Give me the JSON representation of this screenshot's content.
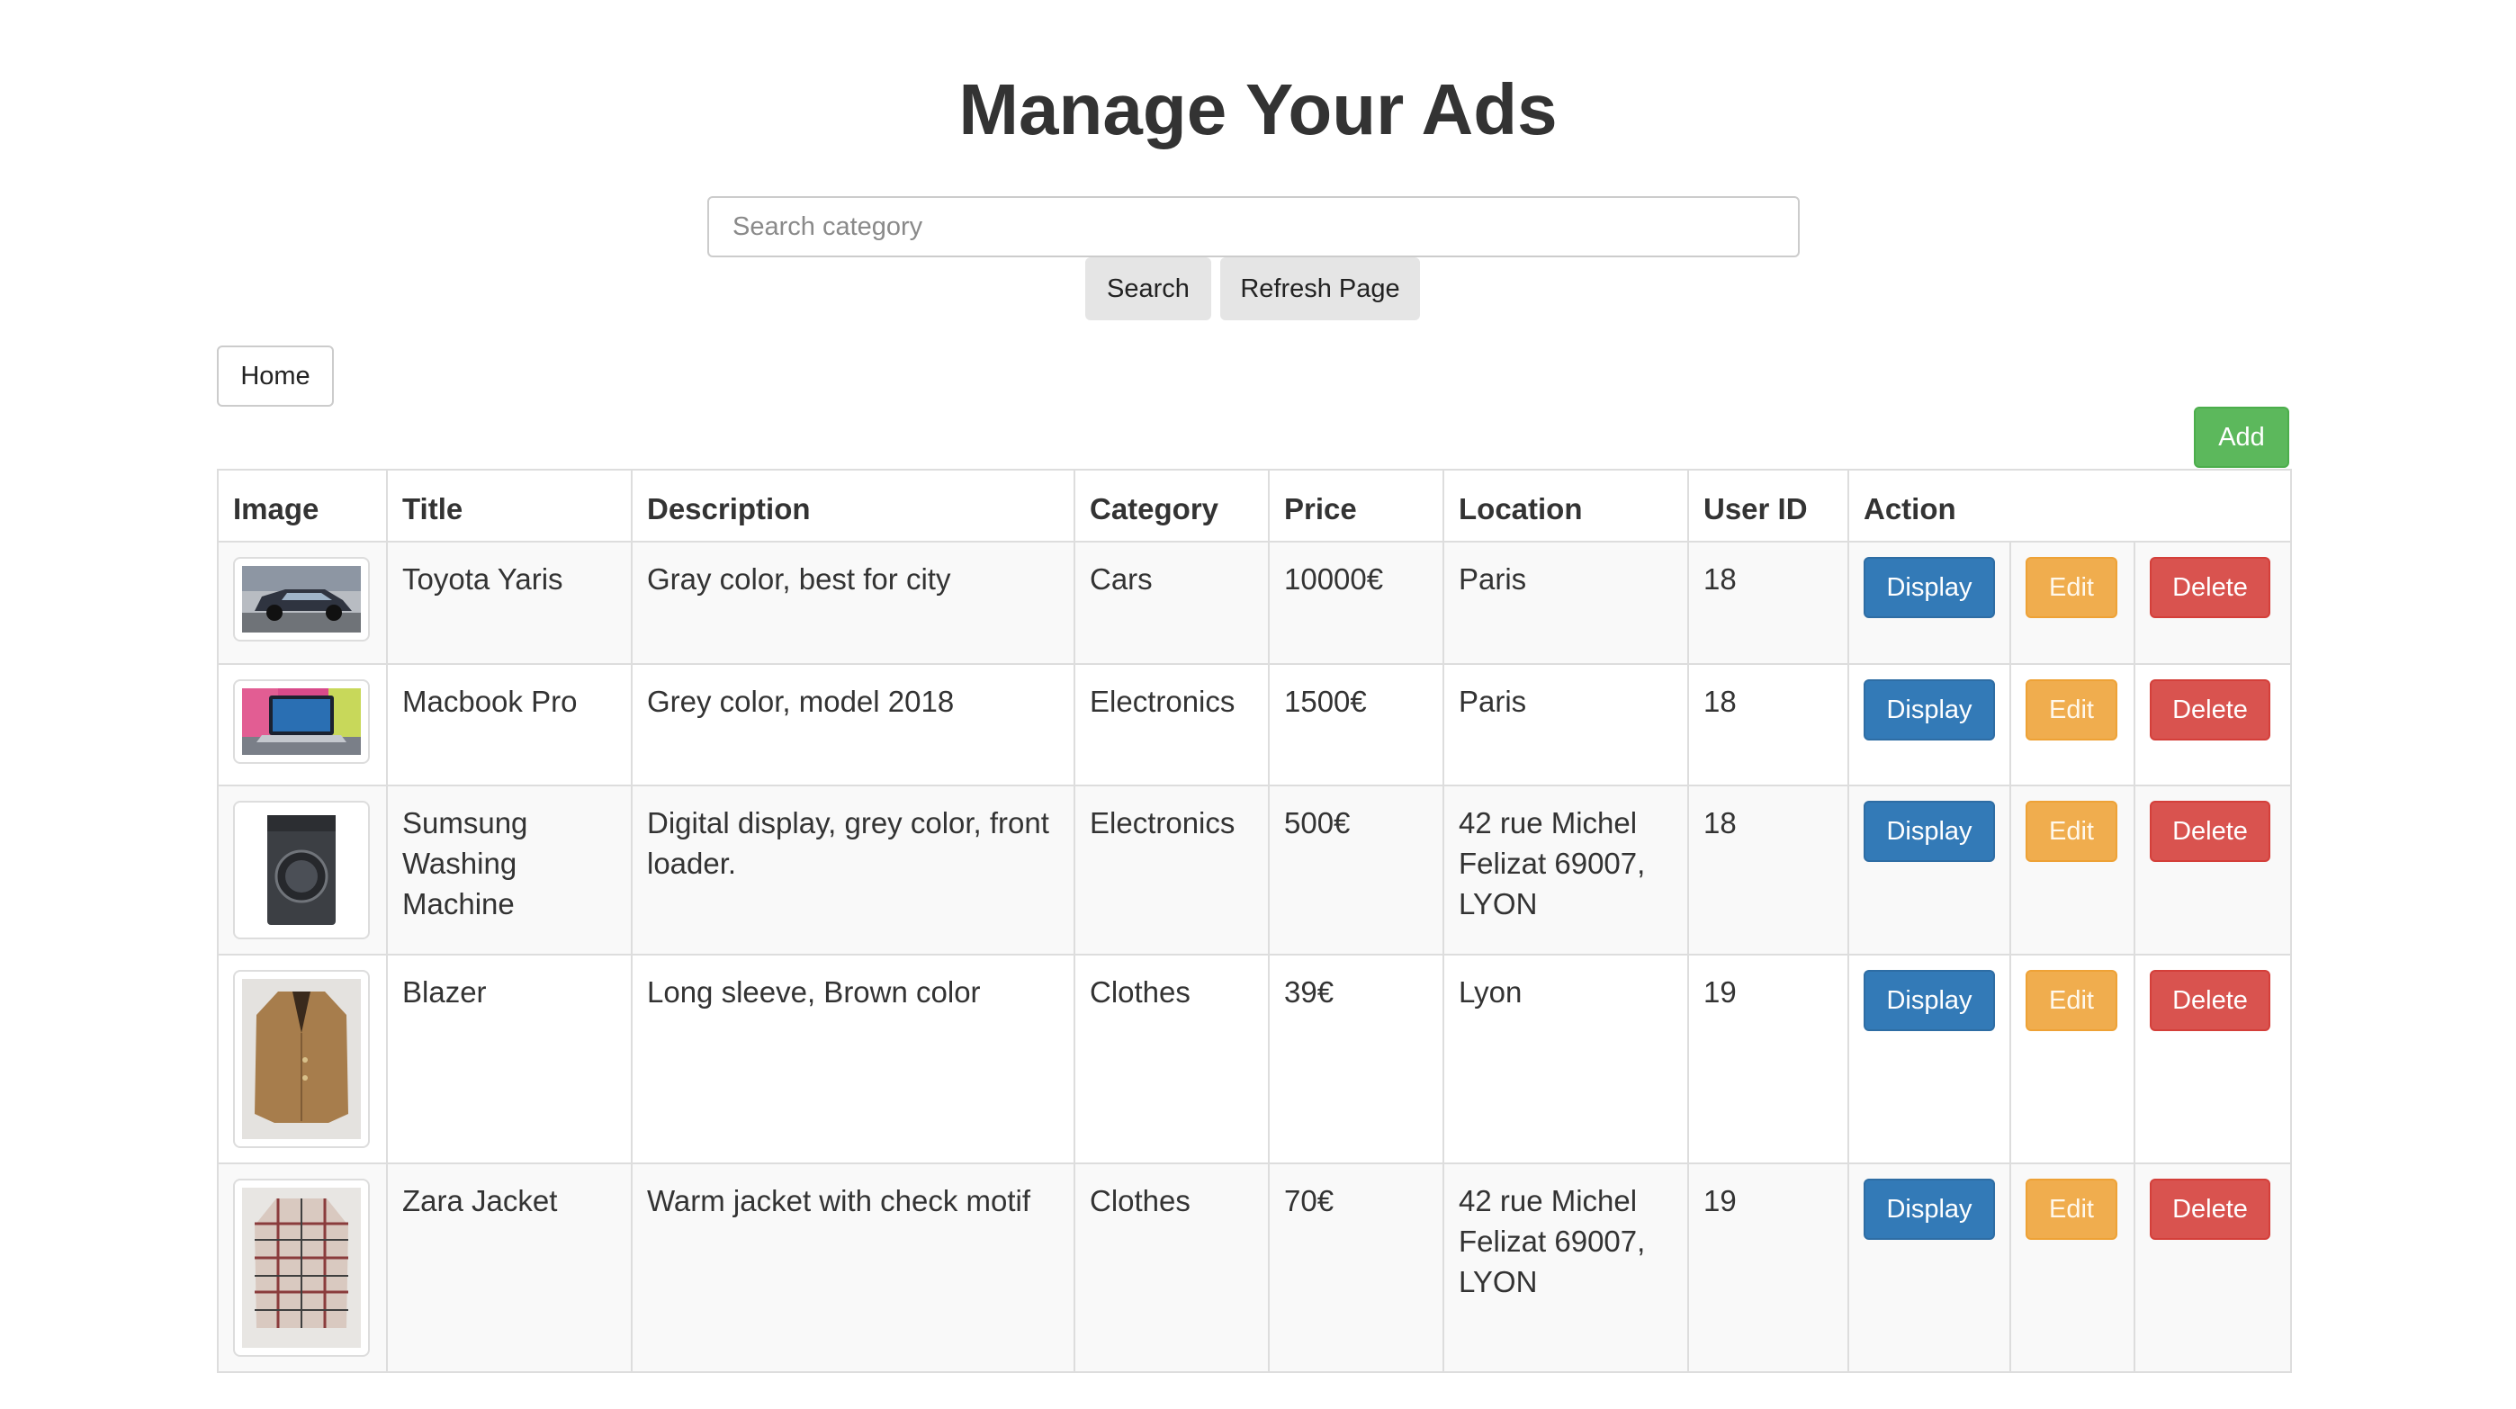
{
  "page": {
    "title": "Manage Your Ads"
  },
  "search": {
    "placeholder": "Search category",
    "value": "",
    "search_label": "Search",
    "refresh_label": "Refresh Page"
  },
  "nav": {
    "home_label": "Home"
  },
  "toolbar": {
    "add_label": "Add"
  },
  "colors": {
    "display": "#337ab7",
    "edit": "#f0ad4e",
    "delete": "#d9534f",
    "add": "#5cb85c"
  },
  "table": {
    "headers": {
      "image": "Image",
      "title": "Title",
      "description": "Description",
      "category": "Category",
      "price": "Price",
      "location": "Location",
      "user_id": "User ID",
      "action": "Action"
    },
    "action_labels": {
      "display": "Display",
      "edit": "Edit",
      "delete": "Delete"
    },
    "rows": [
      {
        "image": "car-photo",
        "title": "Toyota Yaris",
        "description": "Gray color, best for city",
        "category": "Cars",
        "price": "10000€",
        "location": "Paris",
        "user_id": "18"
      },
      {
        "image": "laptop-photo",
        "title": "Macbook Pro",
        "description": "Grey color, model 2018",
        "category": "Electronics",
        "price": "1500€",
        "location": "Paris",
        "user_id": "18"
      },
      {
        "image": "washing-machine-photo",
        "title": "Sumsung Washing Machine",
        "description": "Digital display, grey color, front loader.",
        "category": "Electronics",
        "price": "500€",
        "location": "42 rue Michel Felizat 69007, LYON",
        "user_id": "18"
      },
      {
        "image": "blazer-photo",
        "title": "Blazer",
        "description": "Long sleeve, Brown color",
        "category": "Clothes",
        "price": "39€",
        "location": "Lyon",
        "user_id": "19"
      },
      {
        "image": "jacket-photo",
        "title": "Zara Jacket",
        "description": "Warm jacket with check motif",
        "category": "Clothes",
        "price": "70€",
        "location": "42 rue Michel Felizat 69007, LYON",
        "user_id": "19"
      }
    ]
  }
}
